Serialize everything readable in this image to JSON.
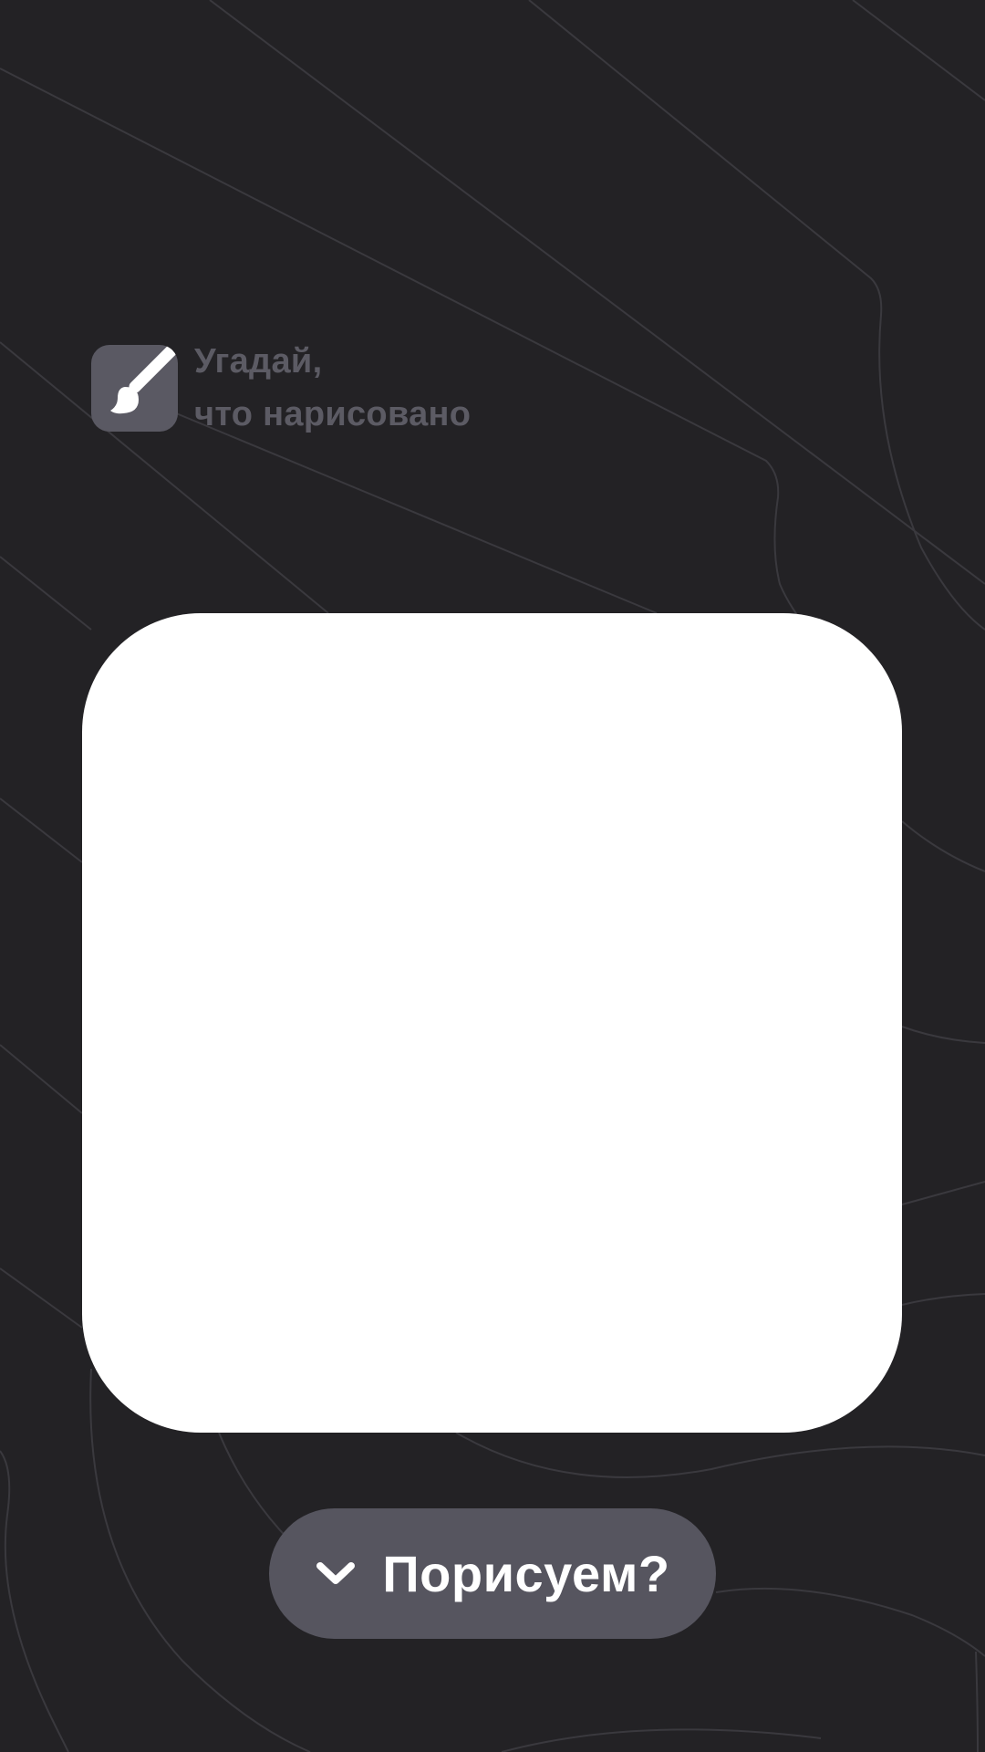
{
  "logo": {
    "icon": "paintbrush-icon",
    "line1": "Угадай,",
    "line2": "что нарисовано"
  },
  "cta": {
    "icon": "chevron-down-icon",
    "label": "Порисуем?"
  },
  "colors": {
    "background": "#232225",
    "line": "#3b3a3f",
    "badge": "#5a5963",
    "logo_text": "#5c5b64",
    "canvas": "#ffffff",
    "button": "#56555f",
    "button_text": "#ffffff"
  }
}
